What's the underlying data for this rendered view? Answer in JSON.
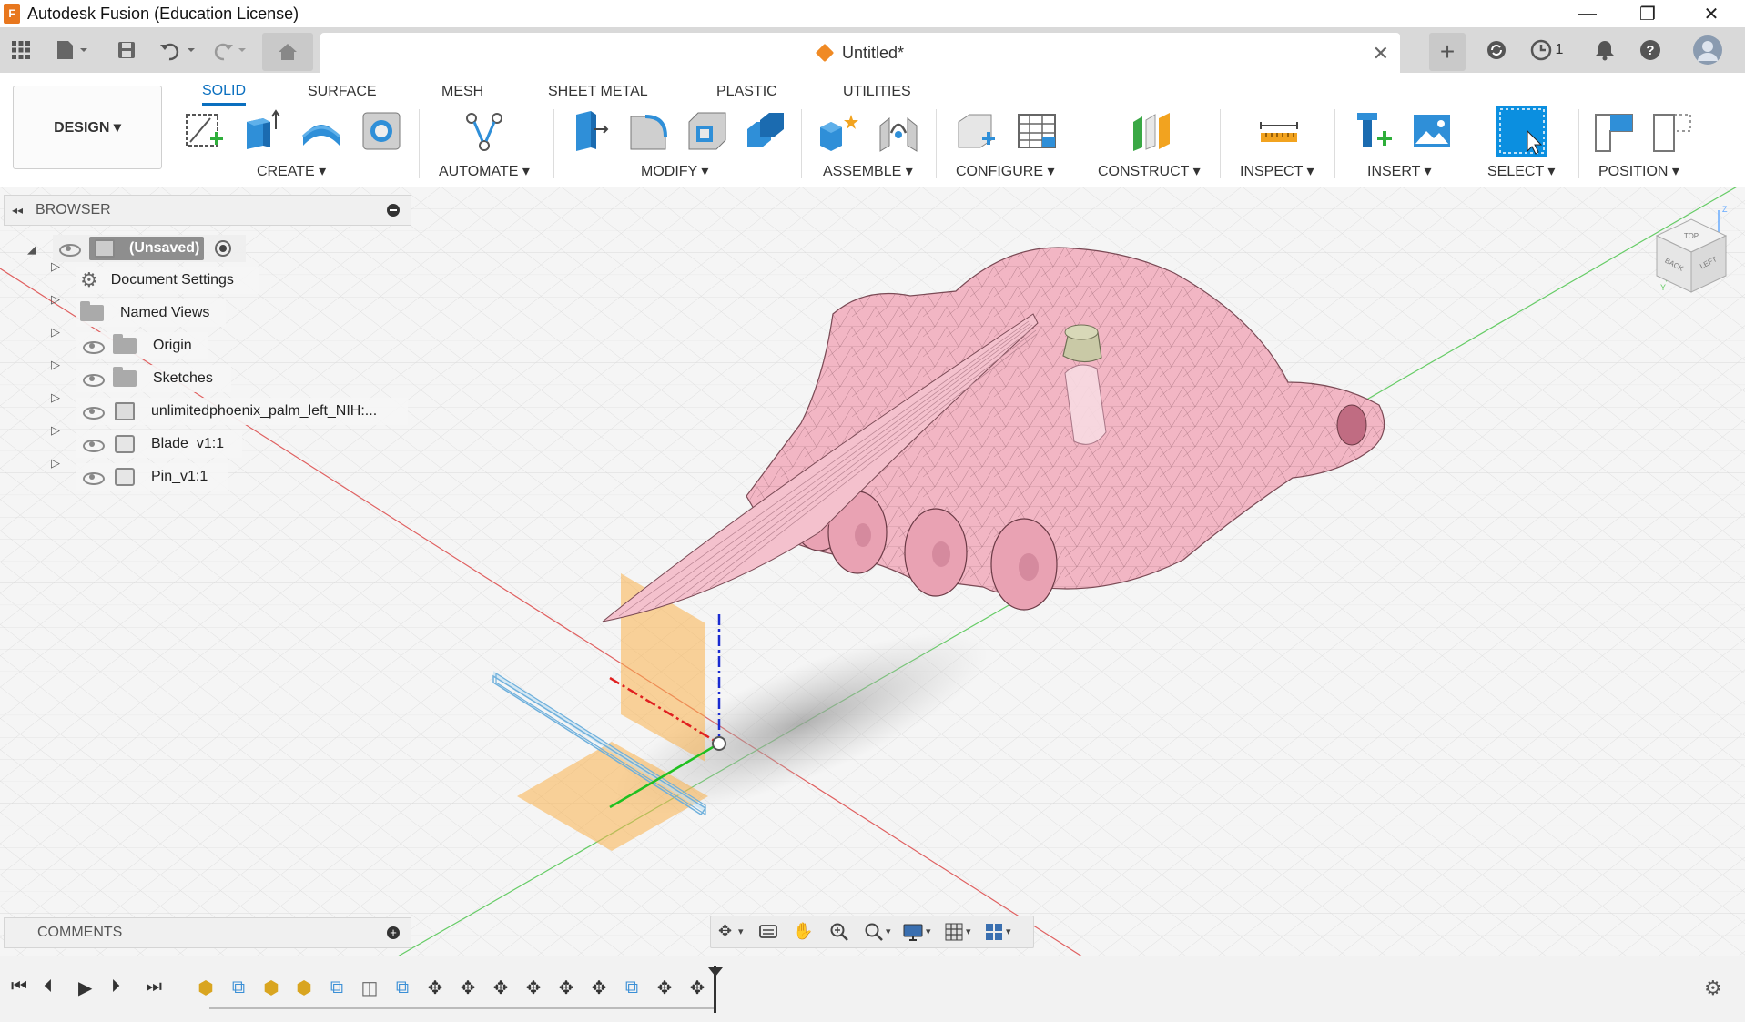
{
  "app": {
    "title": "Autodesk Fusion (Education License)",
    "icon_text": "F"
  },
  "window_controls": {
    "minimize": "—",
    "maximize": "❐",
    "close": "✕"
  },
  "document_tab": {
    "name": "Untitled*",
    "close": "✕",
    "icon": "document-cube-icon"
  },
  "tabbar_right": {
    "job_count": "1"
  },
  "toolbar": {
    "workspace": "DESIGN ▾",
    "tabs": [
      "SOLID",
      "SURFACE",
      "MESH",
      "SHEET METAL",
      "PLASTIC",
      "UTILITIES"
    ],
    "active_tab": "SOLID",
    "groups": [
      {
        "label": "CREATE ▾"
      },
      {
        "label": "AUTOMATE ▾"
      },
      {
        "label": "MODIFY ▾"
      },
      {
        "label": "ASSEMBLE ▾"
      },
      {
        "label": "CONFIGURE ▾"
      },
      {
        "label": "CONSTRUCT ▾"
      },
      {
        "label": "INSPECT ▾"
      },
      {
        "label": "INSERT ▾"
      },
      {
        "label": "SELECT ▾"
      },
      {
        "label": "POSITION ▾"
      }
    ]
  },
  "browser": {
    "header": "BROWSER",
    "root": "(Unsaved)",
    "items": [
      {
        "label": "Document Settings",
        "icon": "gear-icon"
      },
      {
        "label": "Named Views",
        "icon": "folder-icon"
      },
      {
        "label": "Origin",
        "icon": "folder-icon"
      },
      {
        "label": "Sketches",
        "icon": "folder-icon"
      },
      {
        "label": "unlimitedphoenix_palm_left_NIH:...",
        "icon": "component-icon"
      },
      {
        "label": "Blade_v1:1",
        "icon": "body-icon"
      },
      {
        "label": "Pin_v1:1",
        "icon": "body-icon"
      }
    ]
  },
  "comments": {
    "label": "COMMENTS"
  },
  "viewcube": {
    "faces": [
      "TOP",
      "BACK",
      "LEFT"
    ],
    "axes": [
      "Z",
      "Y"
    ]
  },
  "colors": {
    "accent": "#0a6fbf",
    "model_pink": "#f2b6c4",
    "model_edge": "#7a4a55",
    "plane_orange": "#f9b04a",
    "axis_red": "#e02020",
    "axis_green": "#20c020",
    "axis_blue": "#1a2bd0"
  }
}
